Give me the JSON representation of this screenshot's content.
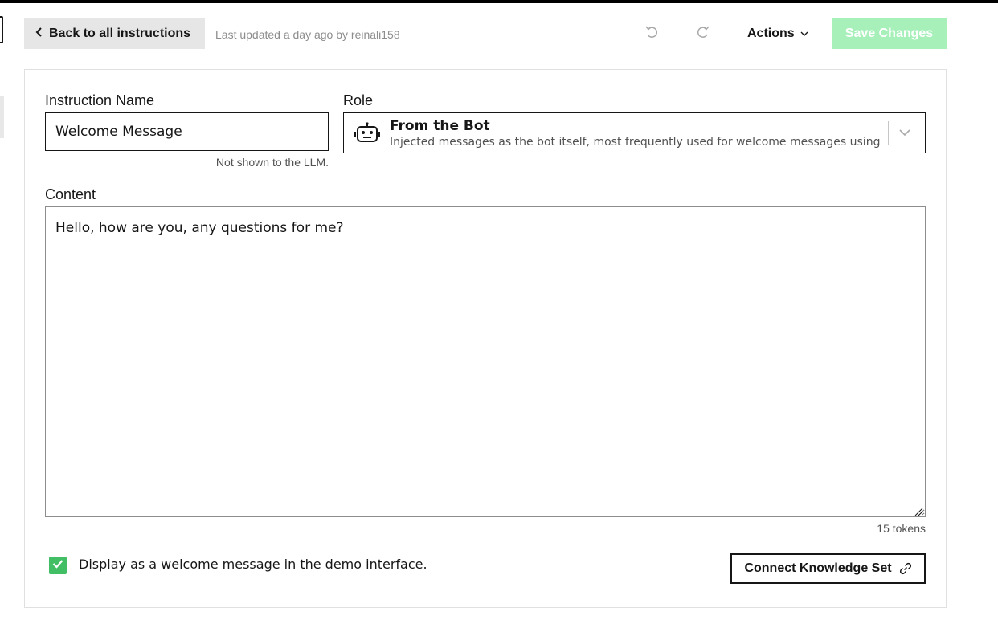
{
  "header": {
    "back_label": "Back to all instructions",
    "last_updated": "Last updated a day ago by reinali158",
    "actions_label": "Actions",
    "save_label": "Save Changes"
  },
  "form": {
    "name_label": "Instruction Name",
    "name_value": "Welcome Message",
    "name_helper": "Not shown to the LLM.",
    "role_label": "Role",
    "role_title": "From the Bot",
    "role_description": "Injected messages as the bot itself, most frequently used for welcome messages using",
    "content_label": "Content",
    "content_value": "Hello, how are you, any questions for me?",
    "tokens": "15 tokens",
    "welcome_checkbox_label": "Display as a welcome message in the demo interface.",
    "welcome_checked": true,
    "connect_label": "Connect Knowledge Set"
  },
  "icons": {
    "undo": "undo-icon",
    "redo": "redo-icon",
    "robot": "robot-icon",
    "link": "link-icon"
  },
  "colors": {
    "save_disabled_bg": "#a7f0ba",
    "checkbox_green": "#42be65",
    "back_button_bg": "#e6e6e6"
  }
}
